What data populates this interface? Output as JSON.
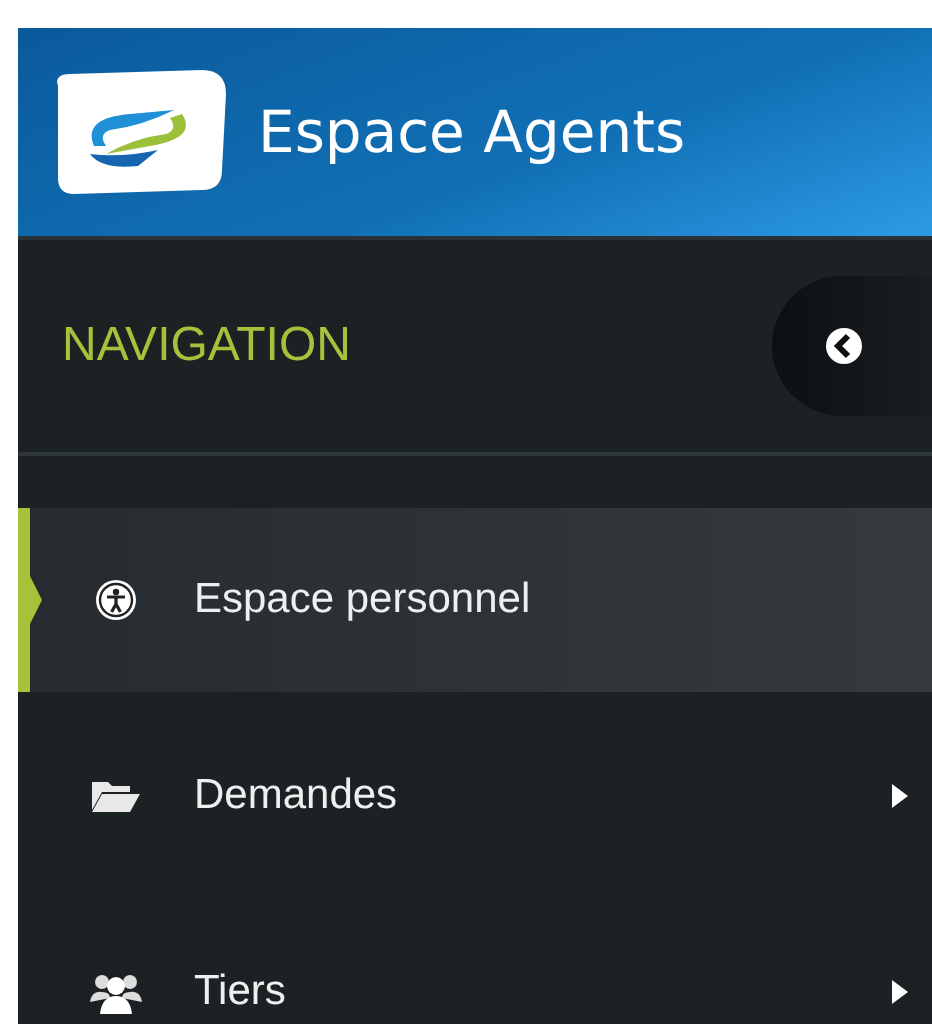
{
  "header": {
    "title": "Espace Agents"
  },
  "navigation": {
    "heading": "NAVIGATION"
  },
  "menu": [
    {
      "label": "Espace personnel",
      "kind": "person",
      "selected": true,
      "has_submenu": false
    },
    {
      "label": "Demandes",
      "kind": "folder",
      "selected": false,
      "has_submenu": true
    },
    {
      "label": "Tiers",
      "kind": "users",
      "selected": false,
      "has_submenu": true
    }
  ]
}
